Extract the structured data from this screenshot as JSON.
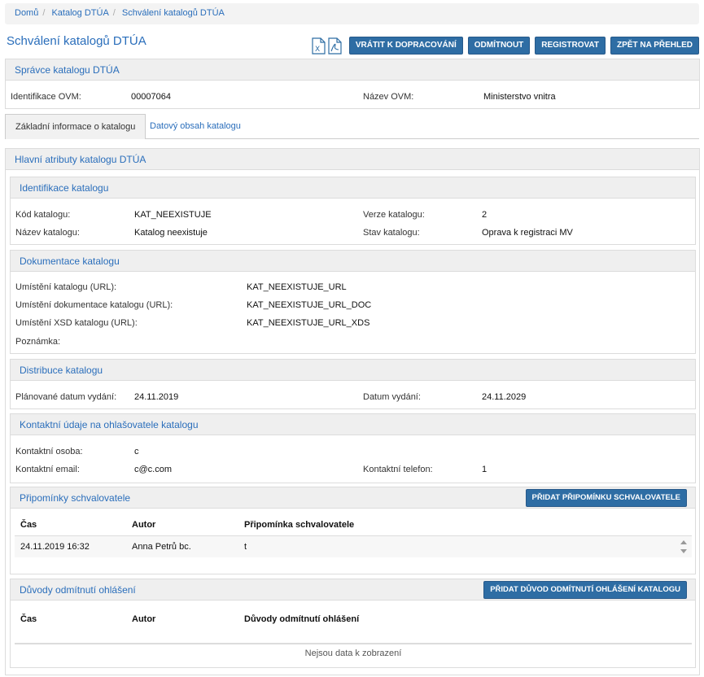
{
  "breadcrumb": [
    "Domů",
    "Katalog DTÚA",
    "Schválení katalogů DTÚA"
  ],
  "page_title": "Schválení katalogů DTÚA",
  "toolbar": {
    "excel_icon": "excel-file-icon",
    "pdf_icon": "pdf-file-icon",
    "buttons": [
      "VRÁTIT K DOPRACOVÁNÍ",
      "ODMÍTNOUT",
      "REGISTROVAT",
      "ZPĚT NA PŘEHLED"
    ]
  },
  "spravce": {
    "title": "Správce katalogu DTÚA",
    "ico_label": "Identifikace OVM:",
    "ico_value": "00007064",
    "ovm_label": "Název OVM:",
    "ovm_value": "Ministerstvo vnitra"
  },
  "tabs": [
    "Základní informace o katalogu",
    "Datový obsah katalogu"
  ],
  "main": {
    "title": "Hlavní atributy katalogu DTÚA",
    "identifikace": {
      "title": "Identifikace katalogu",
      "kod_label": "Kód katalogu:",
      "kod_value": "KAT_NEEXISTUJE",
      "verze_label": "Verze katalogu:",
      "verze_value": "2",
      "nazev_label": "Název katalogu:",
      "nazev_value": "Katalog neexistuje",
      "stav_label": "Stav katalogu:",
      "stav_value": "Oprava k registraci MV"
    },
    "dokumentace": {
      "title": "Dokumentace katalogu",
      "url_label": "Umístění katalogu (URL):",
      "url_value": "KAT_NEEXISTUJE_URL",
      "doc_label": "Umístění dokumentace katalogu (URL):",
      "doc_value": "KAT_NEEXISTUJE_URL_DOC",
      "xsd_label": "Umístění XSD katalogu (URL):",
      "xsd_value": "KAT_NEEXISTUJE_URL_XDS",
      "pozn_label": "Poznámka:"
    },
    "distribuce": {
      "title": "Distribuce katalogu",
      "plan_label": "Plánované datum vydání:",
      "plan_value": "24.11.2019",
      "datum_label": "Datum vydání:",
      "datum_value": "24.11.2029"
    },
    "kontakt": {
      "title": "Kontaktní údaje na ohlašovatele katalogu",
      "osoba_label": "Kontaktní osoba:",
      "osoba_value": "c",
      "email_label": "Kontaktní email:",
      "email_value": "c@c.com",
      "tel_label": "Kontaktní telefon:",
      "tel_value": "1"
    },
    "pripominky": {
      "title": "Připomínky schvalovatele",
      "add_button": "PŘIDAT PŘIPOMÍNKU SCHVALOVATELE",
      "columns": [
        "Čas",
        "Autor",
        "Připomínka schvalovatele"
      ],
      "rows": [
        {
          "cas": "24.11.2019 16:32",
          "autor": "Anna Petrů bc.",
          "text": "t"
        }
      ]
    },
    "duvody": {
      "title": "Důvody odmítnutí ohlášení",
      "add_button": "PŘIDAT DŮVOD ODMÍTNUTÍ OHLÁŠENÍ KATALOGU",
      "columns": [
        "Čas",
        "Autor",
        "Důvody odmítnutí ohlášení"
      ],
      "empty": "Nejsou data k zobrazení"
    }
  },
  "colors": {
    "accent": "#2a6ebb",
    "button": "#2e6da4",
    "panel_head": "#efefef"
  }
}
